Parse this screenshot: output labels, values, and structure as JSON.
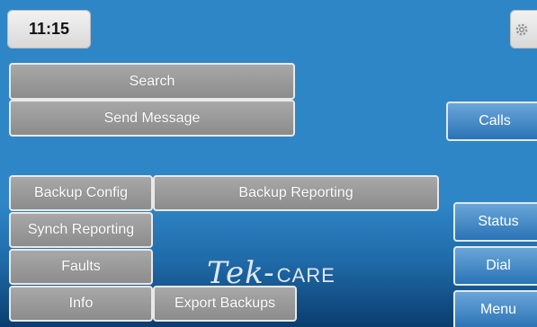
{
  "clock": {
    "time": "11:15"
  },
  "icons": {
    "settings": "gear-icon"
  },
  "buttons": {
    "search": "Search",
    "send_message": "Send Message",
    "calls": "Calls",
    "backup_config": "Backup Config",
    "backup_reporting": "Backup Reporting",
    "synch_reporting": "Synch Reporting",
    "faults": "Faults",
    "info": "Info",
    "export_backups": "Export Backups",
    "status": "Status",
    "dial": "Dial",
    "menu": "Menu"
  },
  "logo": {
    "brand_left": "Tek-",
    "brand_right": "CARE"
  },
  "colors": {
    "background": "#2f86c6",
    "gray_button": "#9a9a9a",
    "blue_button": "#3a82c0"
  }
}
